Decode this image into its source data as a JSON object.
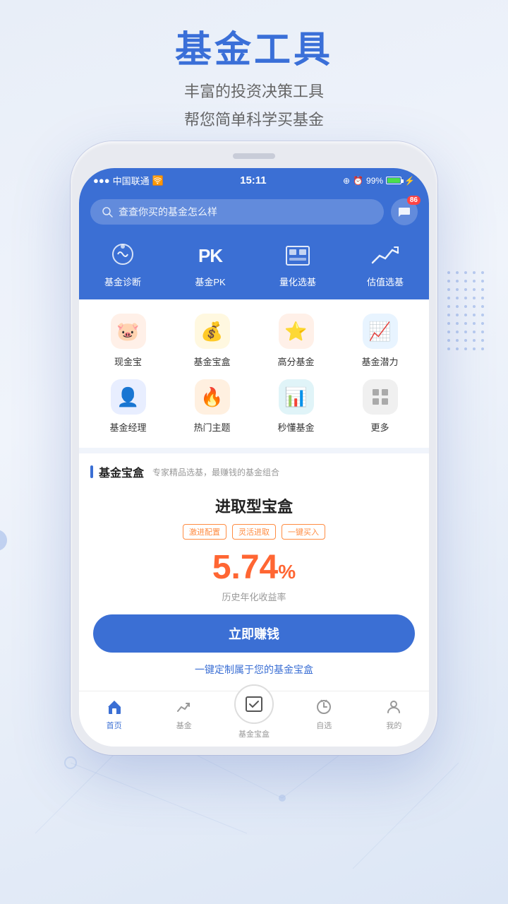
{
  "header": {
    "title": "基金工具",
    "subtitle_line1": "丰富的投资决策工具",
    "subtitle_line2": "帮您简单科学买基金"
  },
  "status_bar": {
    "carrier": "中国联通",
    "time": "15:11",
    "battery": "99%"
  },
  "search": {
    "placeholder": "查查你买的基金怎么样",
    "message_badge": "86"
  },
  "top_nav": [
    {
      "label": "基金诊断",
      "icon": "brain"
    },
    {
      "label": "基金PK",
      "icon": "pk"
    },
    {
      "label": "量化选基",
      "icon": "chart"
    },
    {
      "label": "估值选基",
      "icon": "trend"
    }
  ],
  "grid_row1": [
    {
      "label": "现金宝",
      "icon": "🐷",
      "color": "#fff0e8"
    },
    {
      "label": "基金宝盒",
      "icon": "💰",
      "color": "#fff8e0"
    },
    {
      "label": "高分基金",
      "icon": "⭐",
      "color": "#fff0e8"
    },
    {
      "label": "基金潜力",
      "icon": "📈",
      "color": "#e8f4ff"
    }
  ],
  "grid_row2": [
    {
      "label": "基金经理",
      "icon": "👤",
      "color": "#e8eeff"
    },
    {
      "label": "热门主题",
      "icon": "🔥",
      "color": "#fff0e0"
    },
    {
      "label": "秒懂基金",
      "icon": "📊",
      "color": "#e0f4f8"
    },
    {
      "label": "更多",
      "icon": "⚏",
      "color": "#f0f0f0"
    }
  ],
  "section": {
    "title": "基金宝盒",
    "desc": "专家精品选基，最赚钱的基金组合"
  },
  "card": {
    "title": "进取型宝盒",
    "tags": [
      "激进配置",
      "灵活进取",
      "一键买入"
    ],
    "rate": "5.74",
    "rate_unit": "%",
    "rate_label": "历史年化收益率",
    "cta": "立即赚钱",
    "link": "一键定制属于您的基金宝盒"
  },
  "bottom_tabs": [
    {
      "label": "首页",
      "active": true
    },
    {
      "label": "基金",
      "active": false
    },
    {
      "label": "基金宝盒",
      "active": false,
      "center": true
    },
    {
      "label": "自选",
      "active": false
    },
    {
      "label": "我的",
      "active": false
    }
  ]
}
